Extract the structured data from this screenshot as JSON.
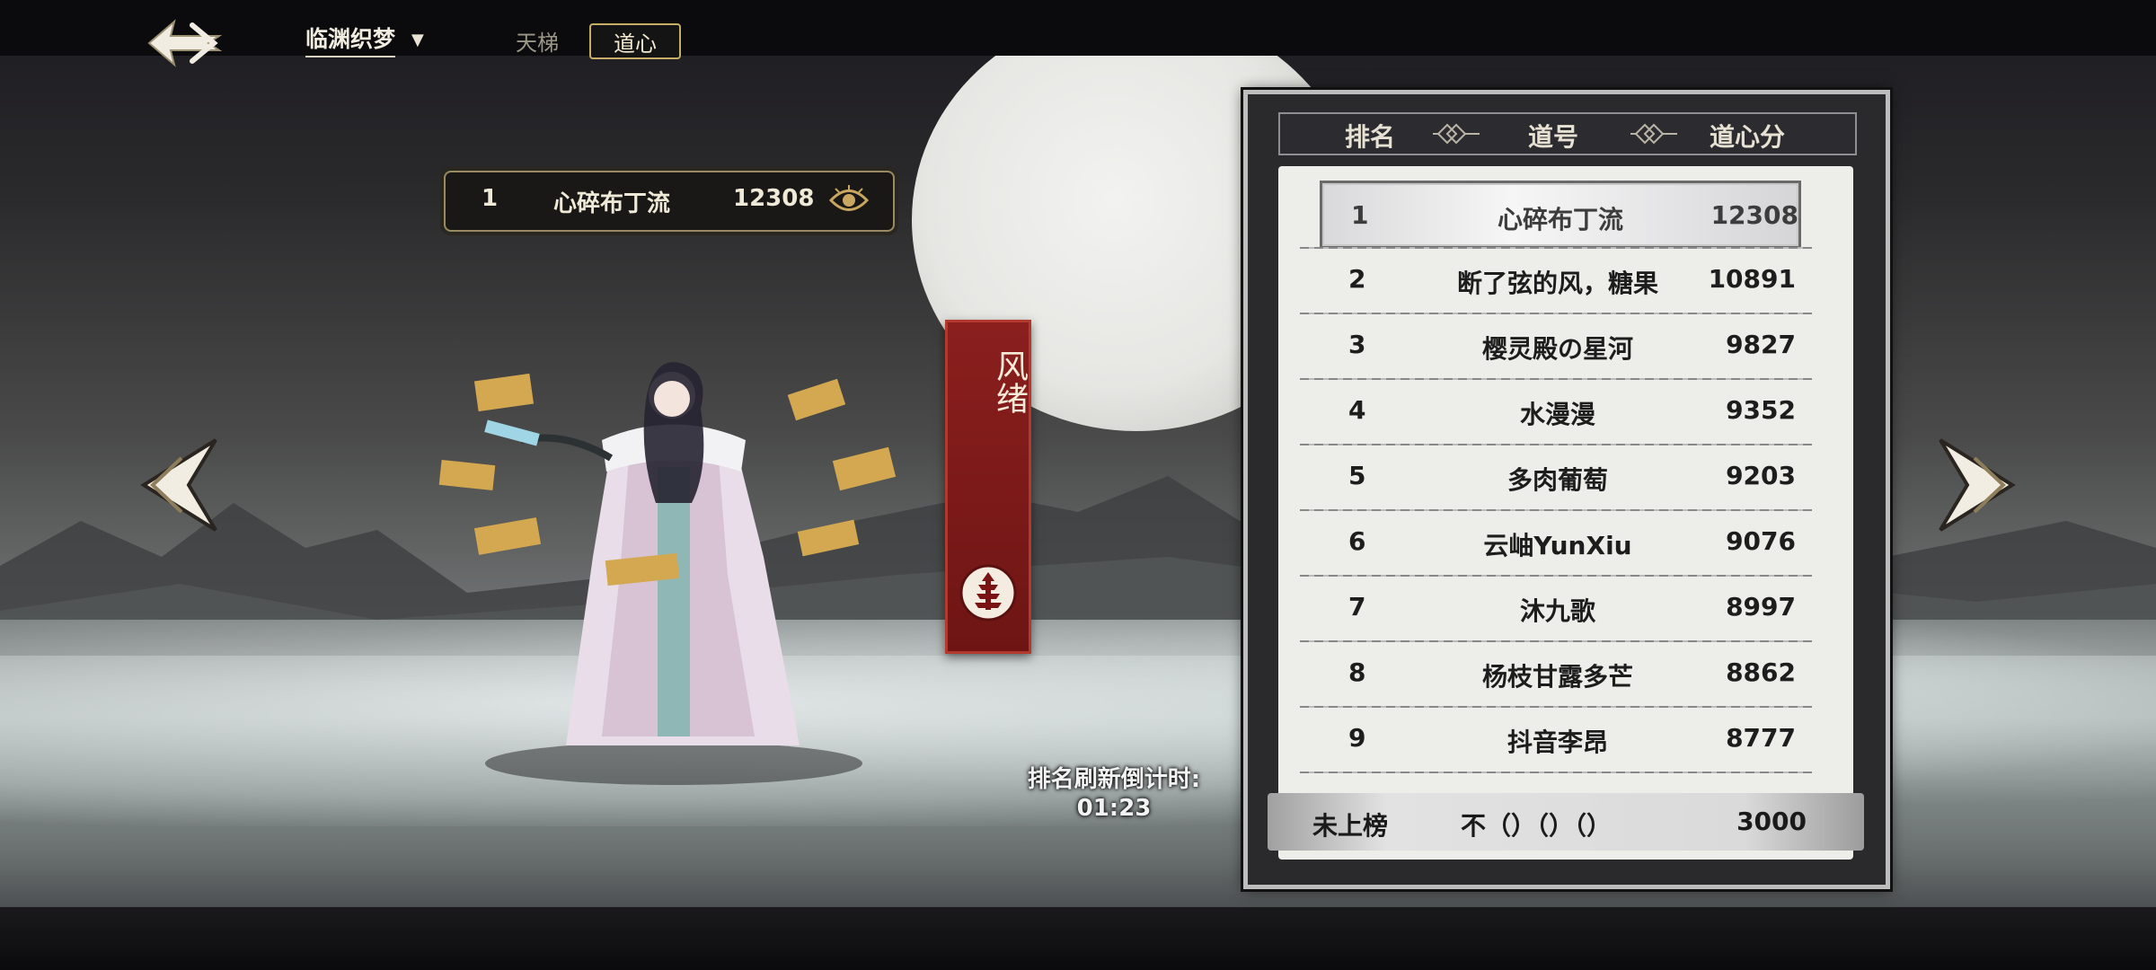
{
  "topbar": {
    "server_name": "临渊织梦",
    "tabs": [
      {
        "label": "天梯",
        "selected": false
      },
      {
        "label": "道心",
        "selected": true
      }
    ]
  },
  "featured": {
    "rank": "1",
    "name": "心碎布丁流",
    "score": "12308"
  },
  "banner": {
    "title": "风绪"
  },
  "countdown": {
    "label": "排名刷新倒计时:",
    "time": "01:23"
  },
  "leaderboard": {
    "headers": {
      "rank": "排名",
      "name": "道号",
      "score": "道心分"
    },
    "rows": [
      {
        "rank": "1",
        "name": "心碎布丁流",
        "score": "12308",
        "highlighted": true
      },
      {
        "rank": "2",
        "name": "断了弦的风，糖果",
        "score": "10891"
      },
      {
        "rank": "3",
        "name": "樱灵殿の星河",
        "score": "9827"
      },
      {
        "rank": "4",
        "name": "水漫漫",
        "score": "9352"
      },
      {
        "rank": "5",
        "name": "多肉葡萄",
        "score": "9203"
      },
      {
        "rank": "6",
        "name": "云岫YunXiu",
        "score": "9076"
      },
      {
        "rank": "7",
        "name": "沐九歌",
        "score": "8997"
      },
      {
        "rank": "8",
        "name": "杨枝甘露多芒",
        "score": "8862"
      },
      {
        "rank": "9",
        "name": "抖音李昂",
        "score": "8777"
      }
    ],
    "self": {
      "label": "未上榜",
      "name": "不（）（）（）",
      "score": "3000"
    }
  },
  "colors": {
    "banner_red": "#7d1b1a",
    "gold_border": "#c7ad68",
    "panel_frame": "#bdbdbd"
  },
  "icons": [
    "back-arrow-icon",
    "chevron-down-icon",
    "eye-icon",
    "pagoda-icon",
    "arrow-left-icon",
    "arrow-right-icon",
    "diamond-separator-icon"
  ]
}
